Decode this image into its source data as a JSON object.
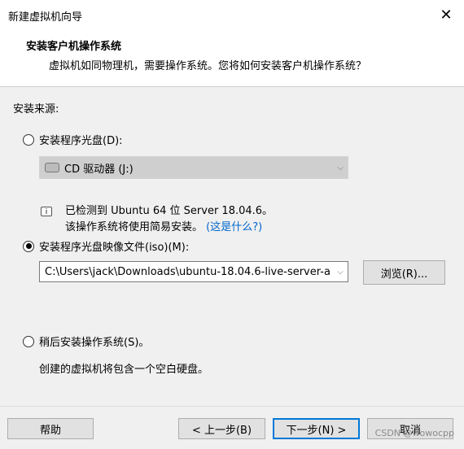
{
  "window": {
    "title": "新建虚拟机向导"
  },
  "header": {
    "title": "安装客户机操作系统",
    "subtitle": "虚拟机如同物理机，需要操作系统。您将如何安装客户机操作系统？"
  },
  "content": {
    "source_label": "安装来源:",
    "option_disc": {
      "label": "安装程序光盘(D):",
      "selected": false
    },
    "disc_drive": {
      "value": "CD 驱动器 (J:)"
    },
    "option_iso": {
      "label": "安装程序光盘映像文件(iso)(M):",
      "selected": true
    },
    "iso_path": {
      "value": "C:\\Users\\jack\\Downloads\\ubuntu-18.04.6-live-server-a"
    },
    "browse_label": "浏览(R)...",
    "detect_line1": "已检测到 Ubuntu 64 位 Server 18.04.6。",
    "detect_line2": "该操作系统将使用简易安装。",
    "detect_link": "(这是什么?)",
    "option_later": {
      "label": "稍后安装操作系统(S)。",
      "selected": false
    },
    "later_desc": "创建的虚拟机将包含一个空白硬盘。"
  },
  "footer": {
    "help": "帮助",
    "back": "< 上一步(B)",
    "next": "下一步(N) >",
    "cancel": "取消"
  },
  "watermark": "CSDN @wowocpp"
}
